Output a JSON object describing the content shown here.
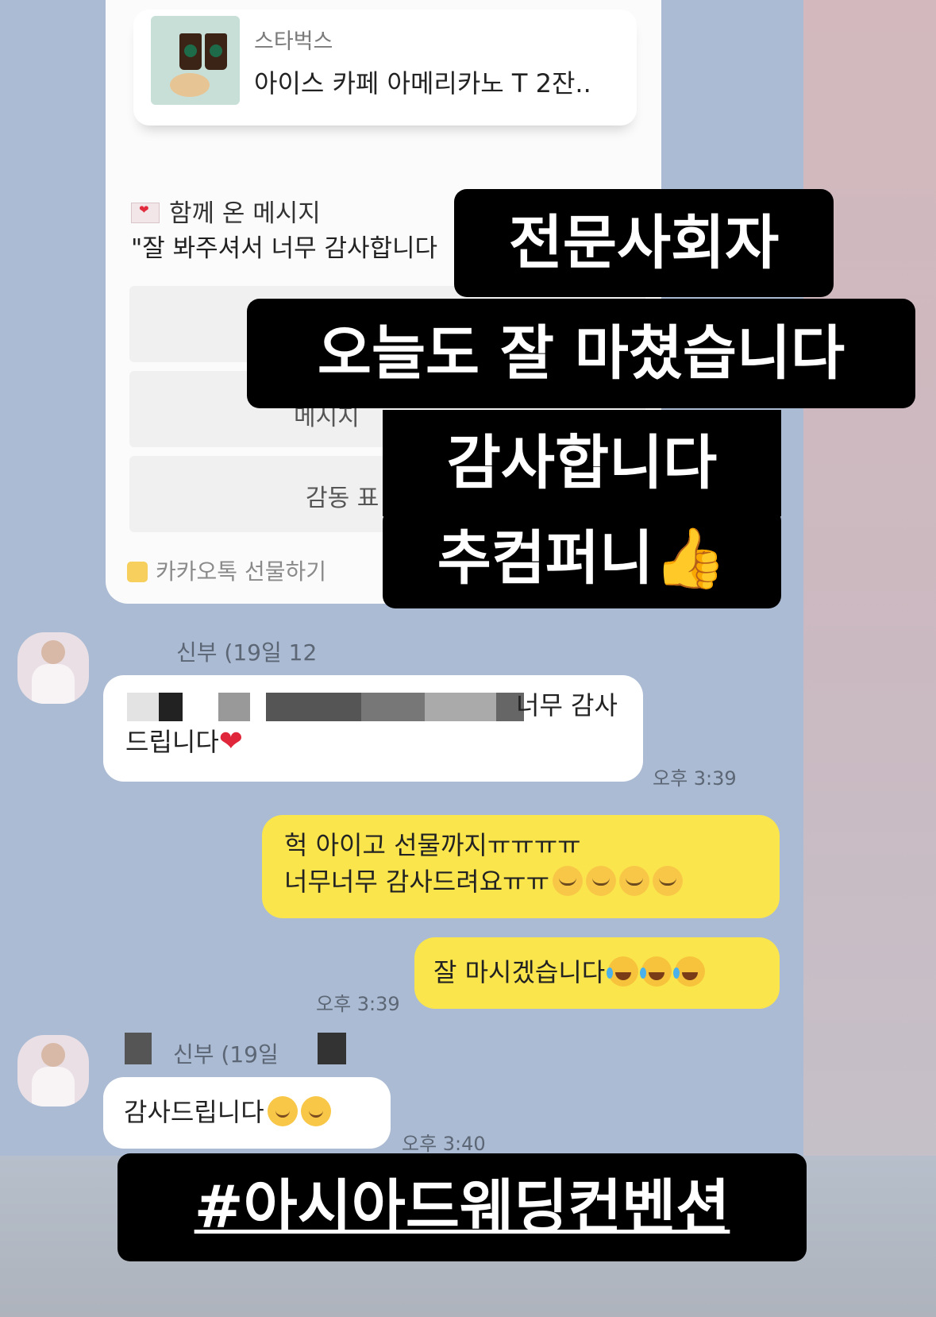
{
  "gift": {
    "brand": "스타벅스",
    "product": "아이스 카페 아메리카노 T 2잔..",
    "message_header": "함께 온 메시지",
    "message_body": "\"잘 봐주셔서 너무 감사합니다",
    "button_partial_1": "메시지",
    "button_partial_2": "감동 표",
    "footer": "카카오톡 선물하기"
  },
  "story_text": {
    "line1": "전문사회자",
    "line2": "오늘도 잘 마쳤습니다",
    "line3": "감사합니다",
    "line4": "추컴퍼니👍",
    "hashtag": "#아시아드웨딩컨벤션"
  },
  "chat": {
    "msg1": {
      "sender": "신부 (19일 12",
      "text_line1_tail": "너무 감사",
      "text_line2": "드립니다",
      "time": "오후 3:39"
    },
    "reply1": {
      "line1": "헉 아이고 선물까지ㅠㅠㅠㅠ",
      "line2": "너무너무 감사드려요ㅠㅠ",
      "emoji": "pleading-face"
    },
    "reply2": {
      "text": "잘 마시겠습니다",
      "time": "오후 3:39",
      "emoji": "tears-of-joy"
    },
    "msg2": {
      "sender": "신부 (19일",
      "text": "감사드립니다",
      "time": "오후 3:40",
      "emoji": "smiling-face"
    }
  }
}
